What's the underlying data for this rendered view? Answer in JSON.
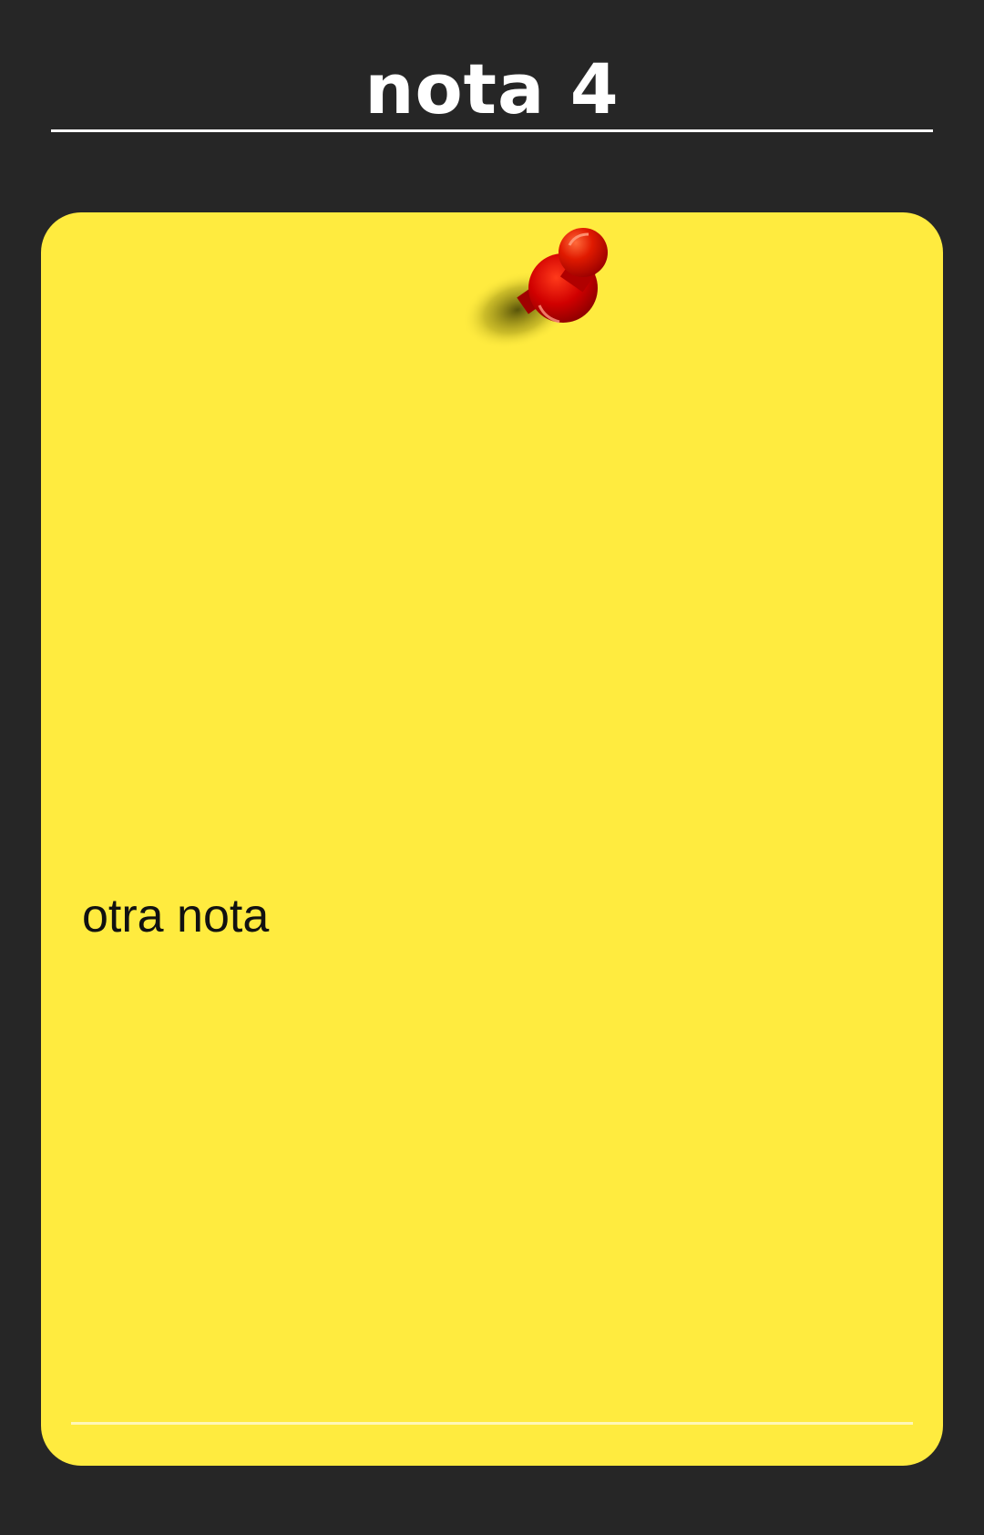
{
  "header": {
    "title": "nota 4"
  },
  "note": {
    "text": "otra nota",
    "background_color": "#ffeb3f",
    "pin_icon": "pushpin-icon",
    "pin_color": "#d40000"
  },
  "theme": {
    "background_color": "#262626",
    "title_color": "#ffffff"
  }
}
